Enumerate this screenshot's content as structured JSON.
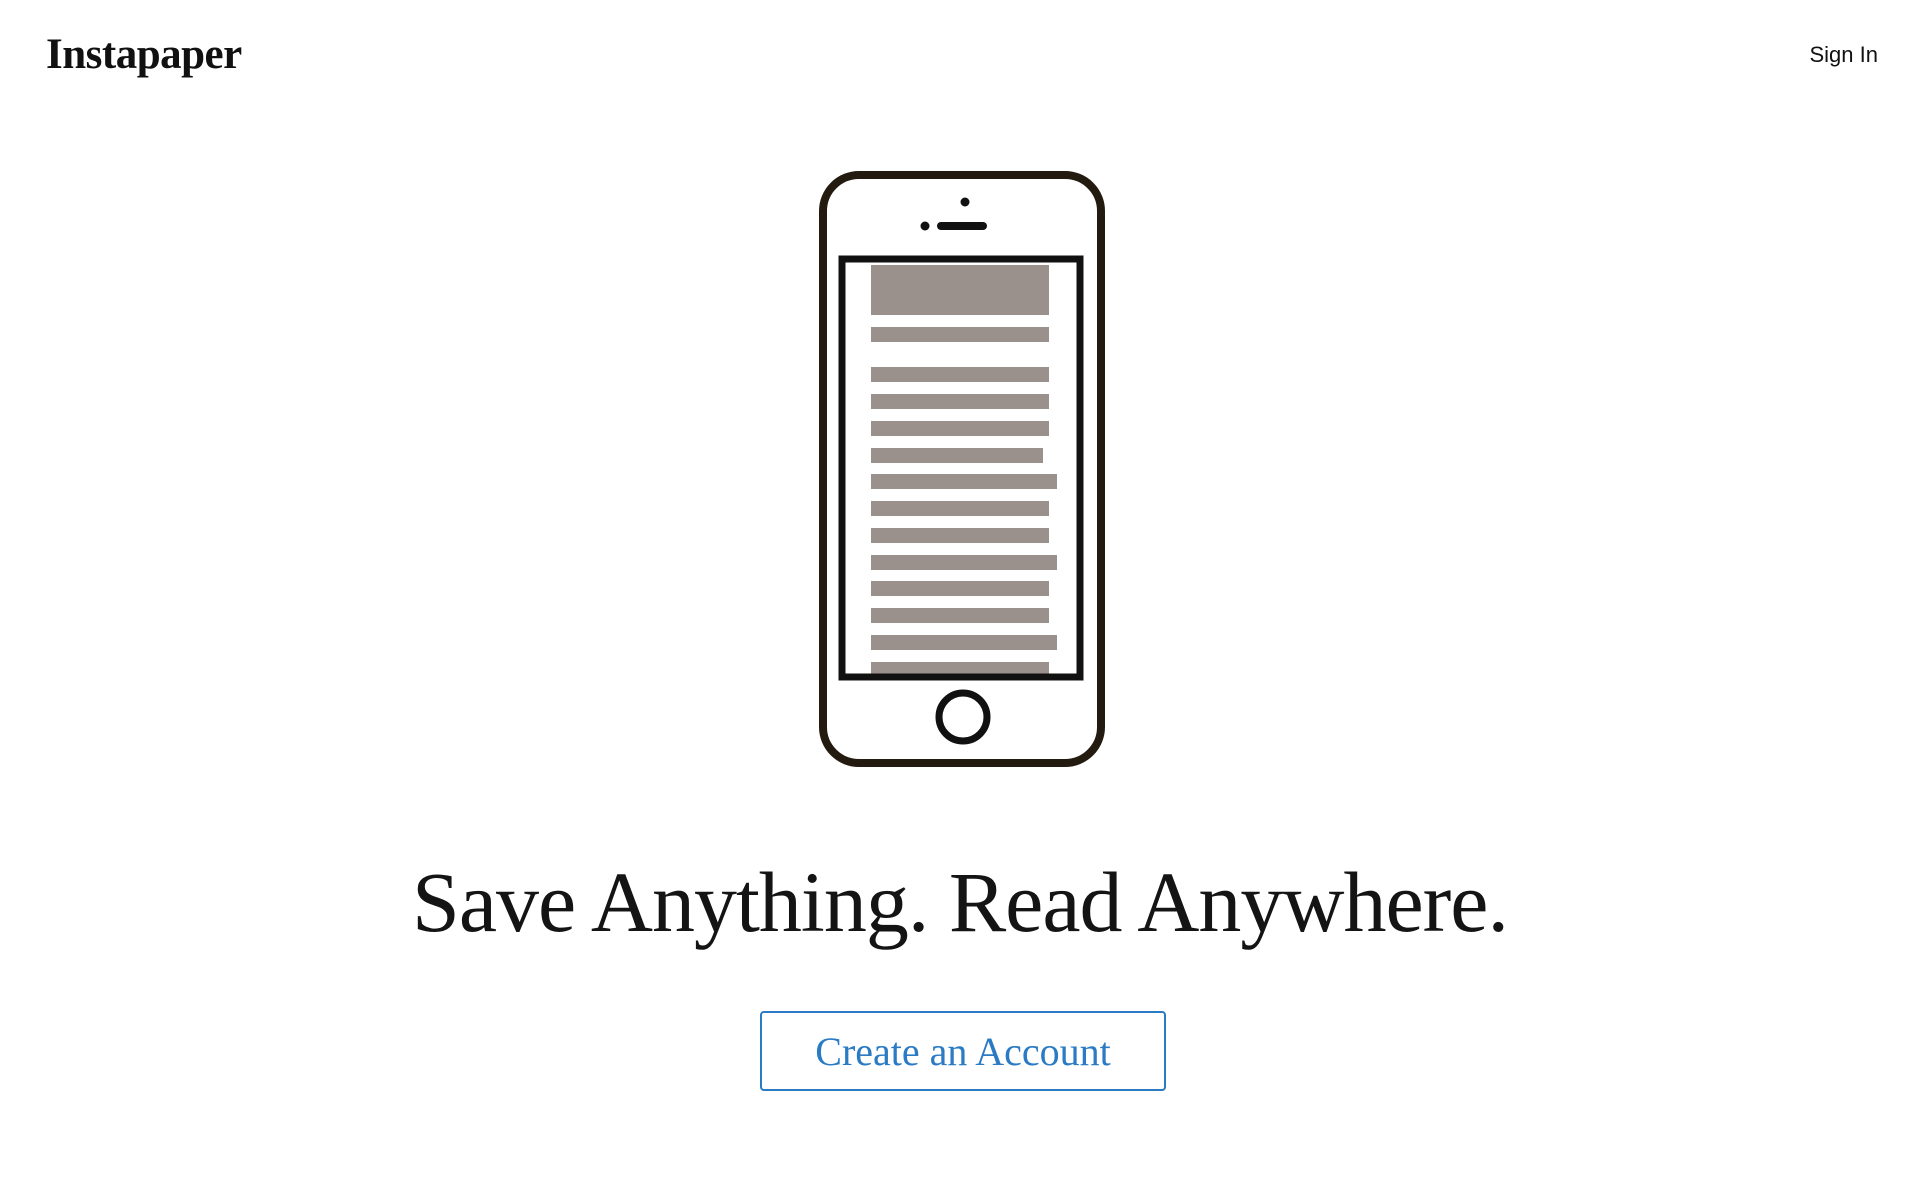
{
  "header": {
    "logo_text": "Instapaper",
    "signin_label": "Sign In"
  },
  "hero": {
    "illustration_icon": "phone-reading-icon",
    "headline": "Save Anything. Read Anywhere.",
    "cta_label": "Create an Account"
  },
  "colors": {
    "accent": "#2a7bc4",
    "phone_outline": "#231a10",
    "text_block": "#9a918c",
    "background": "#ffffff"
  }
}
